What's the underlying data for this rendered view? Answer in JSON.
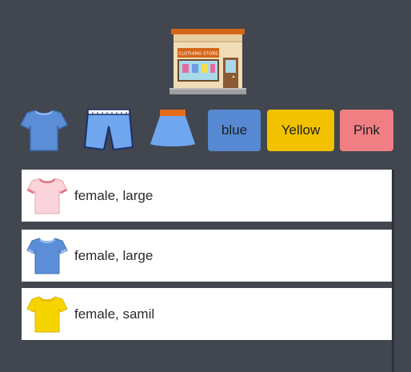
{
  "store": {
    "sign": "CLOTHING STORE",
    "icon": "clothing-store-icon"
  },
  "filters": {
    "types": [
      {
        "icon": "tshirt-icon",
        "color": "#5b8ed6"
      },
      {
        "icon": "shorts-icon",
        "color": "#6fa6ee"
      },
      {
        "icon": "skirt-icon",
        "color": "#6fa6ee"
      }
    ],
    "colors": [
      {
        "label": "blue",
        "color": "#5689d1"
      },
      {
        "label": "Yellow",
        "color": "#f2c200"
      },
      {
        "label": "Pink",
        "color": "#ef7f83"
      }
    ]
  },
  "items": [
    {
      "icon": "tshirt-icon",
      "shirt_color": "#fbd3da",
      "description": "female, large"
    },
    {
      "icon": "tshirt-icon",
      "shirt_color": "#5b8ed6",
      "description": "female, large"
    },
    {
      "icon": "tshirt-icon",
      "shirt_color": "#f6d400",
      "description": "female, samil"
    }
  ]
}
